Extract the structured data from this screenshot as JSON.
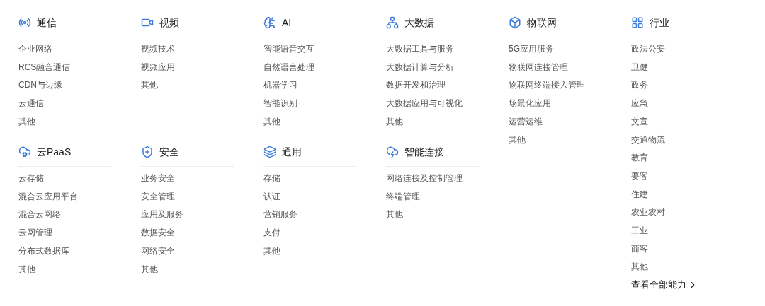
{
  "columns": [
    {
      "sections": [
        {
          "title": "通信",
          "items": [
            "企业网络",
            "RCS融合通信",
            "CDN与边缘",
            "云通信",
            "其他"
          ]
        },
        {
          "title": "云PaaS",
          "items": [
            "云存储",
            "混合云应用平台",
            "混合云网络",
            "云网管理",
            "分布式数据库",
            "其他"
          ]
        }
      ]
    },
    {
      "sections": [
        {
          "title": "视频",
          "items": [
            "视频技术",
            "视频应用",
            "其他"
          ]
        },
        {
          "title": "安全",
          "items": [
            "业务安全",
            "安全管理",
            "应用及服务",
            "数据安全",
            "网络安全",
            "其他"
          ]
        }
      ]
    },
    {
      "sections": [
        {
          "title": "AI",
          "items": [
            "智能语音交互",
            "自然语言处理",
            "机器学习",
            "智能识别",
            "其他"
          ]
        },
        {
          "title": "通用",
          "items": [
            "存储",
            "认证",
            "营销服务",
            "支付",
            "其他"
          ]
        }
      ]
    },
    {
      "sections": [
        {
          "title": "大数据",
          "items": [
            "大数据工具与服务",
            "大数据计算与分析",
            "数据开发和治理",
            "大数据应用与可视化",
            "其他"
          ]
        },
        {
          "title": "智能连接",
          "items": [
            "网络连接及控制管理",
            "终端管理",
            "其他"
          ]
        }
      ]
    },
    {
      "sections": [
        {
          "title": "物联网",
          "items": [
            "5G应用服务",
            "物联网连接管理",
            "物联网终端接入管理",
            "场景化应用",
            "运营运维",
            "其他"
          ]
        }
      ]
    },
    {
      "sections": [
        {
          "title": "行业",
          "items": [
            "政法公安",
            "卫健",
            "政务",
            "应急",
            "文宣",
            "交通物流",
            "教育",
            "要客",
            "住建",
            "农业农村",
            "工业",
            "商客",
            "其他"
          ]
        }
      ],
      "link": "查看全部能力"
    }
  ]
}
